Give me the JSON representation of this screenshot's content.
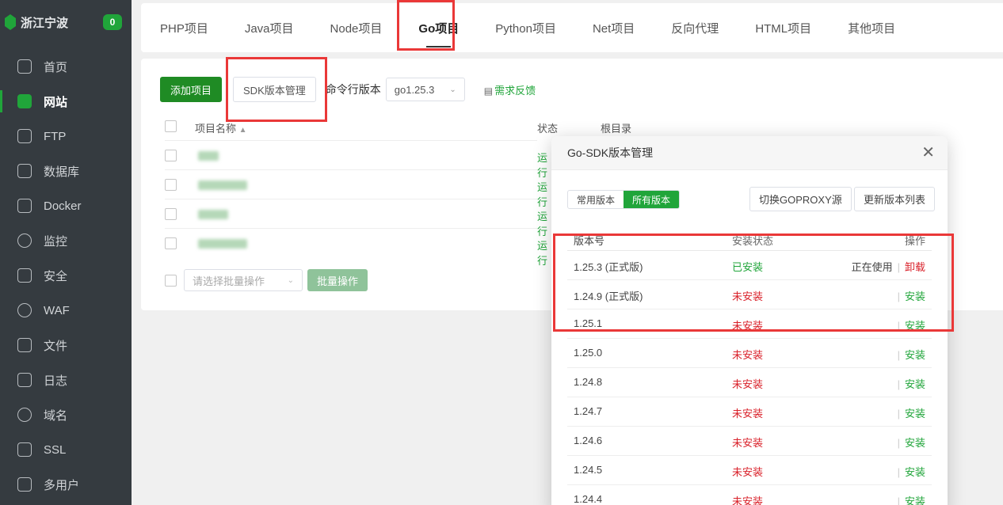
{
  "sidebar": {
    "title": "浙江宁波",
    "badge": "0",
    "items": [
      {
        "label": "首页",
        "icon": "home-icon",
        "active": false
      },
      {
        "label": "网站",
        "icon": "website-icon",
        "active": true
      },
      {
        "label": "FTP",
        "icon": "ftp-icon",
        "active": false
      },
      {
        "label": "数据库",
        "icon": "database-icon",
        "active": false
      },
      {
        "label": "Docker",
        "icon": "docker-icon",
        "active": false
      },
      {
        "label": "监控",
        "icon": "monitor-icon",
        "active": false
      },
      {
        "label": "安全",
        "icon": "shield-icon",
        "active": false
      },
      {
        "label": "WAF",
        "icon": "waf-icon",
        "active": false
      },
      {
        "label": "文件",
        "icon": "folder-icon",
        "active": false
      },
      {
        "label": "日志",
        "icon": "log-icon",
        "active": false
      },
      {
        "label": "域名",
        "icon": "globe-icon",
        "active": false
      },
      {
        "label": "SSL",
        "icon": "ssl-icon",
        "active": false
      },
      {
        "label": "多用户",
        "icon": "users-icon",
        "active": false
      }
    ]
  },
  "tabs": [
    "PHP项目",
    "Java项目",
    "Node项目",
    "Go项目",
    "Python项目",
    "Net项目",
    "反向代理",
    "HTML项目",
    "其他项目"
  ],
  "active_tab": "Go项目",
  "toolbar": {
    "add_project": "添加项目",
    "sdk_manage": "SDK版本管理",
    "cmd_version_label": "命令行版本",
    "cmd_version_value": "go1.25.3",
    "feedback": "需求反馈"
  },
  "project_table": {
    "headers": {
      "name": "项目名称",
      "status": "状态",
      "root": "根目录"
    },
    "rows": [
      {
        "status": "运行"
      },
      {
        "status": "运行"
      },
      {
        "status": "运行"
      },
      {
        "status": "运行"
      }
    ],
    "batch_placeholder": "请选择批量操作",
    "batch_button": "批量操作"
  },
  "modal": {
    "title": "Go-SDK版本管理",
    "seg_common": "常用版本",
    "seg_all": "所有版本",
    "switch_proxy": "切换GOPROXY源",
    "refresh_list": "更新版本列表",
    "headers": {
      "version": "版本号",
      "status": "安装状态",
      "action": "操作"
    },
    "rows": [
      {
        "version": "1.25.3 (正式版)",
        "status": "已安装",
        "installed": true,
        "in_use": "正在使用",
        "action": "卸载"
      },
      {
        "version": "1.24.9 (正式版)",
        "status": "未安装",
        "installed": false,
        "in_use": "",
        "action": "安装"
      },
      {
        "version": "1.25.1",
        "status": "未安装",
        "installed": false,
        "in_use": "",
        "action": "安装"
      },
      {
        "version": "1.25.0",
        "status": "未安装",
        "installed": false,
        "in_use": "",
        "action": "安装"
      },
      {
        "version": "1.24.8",
        "status": "未安装",
        "installed": false,
        "in_use": "",
        "action": "安装"
      },
      {
        "version": "1.24.7",
        "status": "未安装",
        "installed": false,
        "in_use": "",
        "action": "安装"
      },
      {
        "version": "1.24.6",
        "status": "未安装",
        "installed": false,
        "in_use": "",
        "action": "安装"
      },
      {
        "version": "1.24.5",
        "status": "未安装",
        "installed": false,
        "in_use": "",
        "action": "安装"
      },
      {
        "version": "1.24.4",
        "status": "未安装",
        "installed": false,
        "in_use": "",
        "action": "安装"
      }
    ]
  },
  "colors": {
    "accent": "#20a53a",
    "danger": "#d9212a",
    "annotation": "#ea3838"
  }
}
